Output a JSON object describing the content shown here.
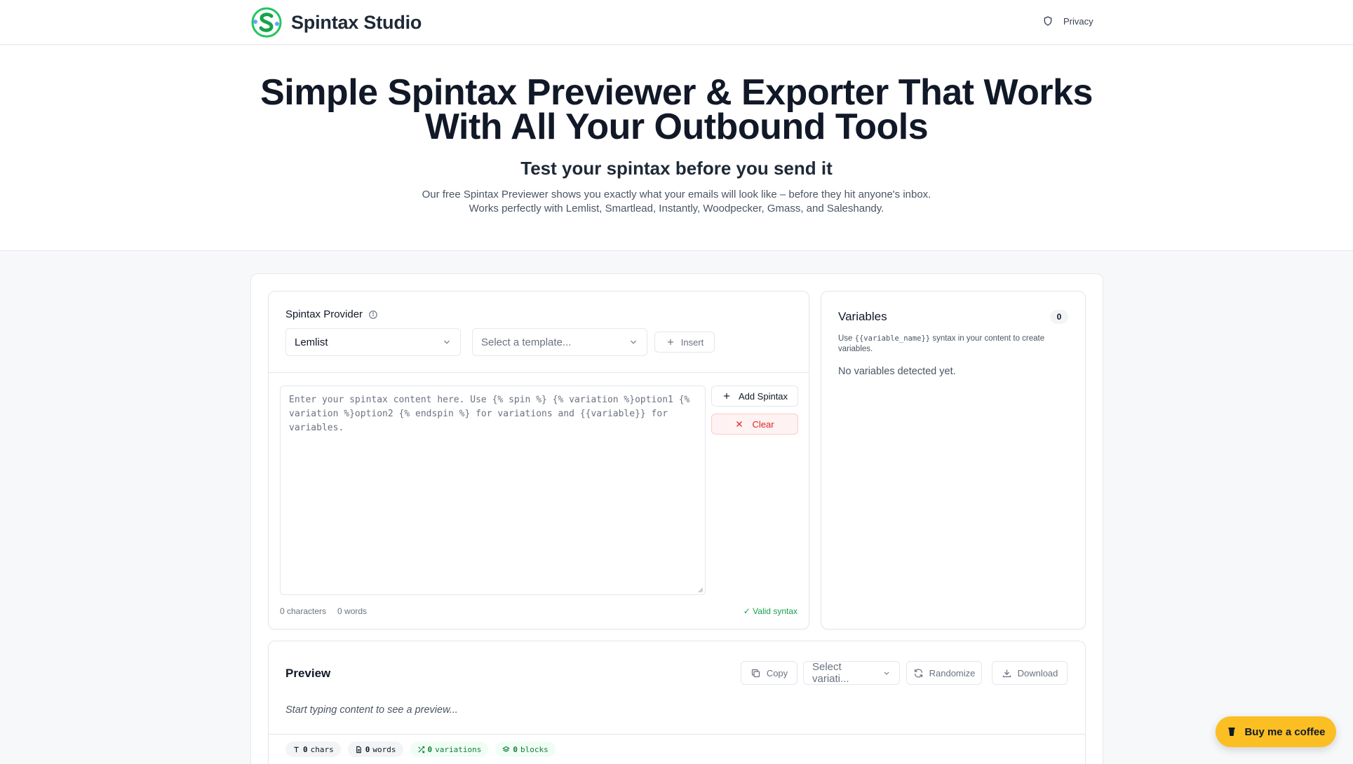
{
  "header": {
    "brand": "Spintax Studio",
    "privacy_label": "Privacy"
  },
  "hero": {
    "title_line1": "Simple Spintax Previewer & Exporter That Works",
    "title_line2": "With All Your Outbound Tools",
    "subtitle": "Test your spintax before you send it",
    "desc_line1": "Our free Spintax Previewer shows you exactly what your emails will look like – before they hit anyone's inbox.",
    "desc_line2": "Works perfectly with Lemlist, Smartlead, Instantly, Woodpecker, Gmass, and Saleshandy."
  },
  "editor": {
    "provider_label": "Spintax Provider",
    "provider_value": "Lemlist",
    "template_placeholder": "Select a template...",
    "insert_label": "Insert",
    "textarea_placeholder": "Enter your spintax content here. Use {% spin %} {% variation %}option1 {% variation %}option2 {% endspin %} for variations and {{variable}} for variables.",
    "add_spintax_label": "Add Spintax",
    "clear_label": "Clear",
    "characters": "0 characters",
    "words": "0 words",
    "valid": "✓ Valid syntax"
  },
  "variables": {
    "title": "Variables",
    "count": "0",
    "help_prefix": "Use ",
    "help_code": "{{variable_name}}",
    "help_suffix": " syntax in your content to create variables.",
    "empty": "No variables detected yet."
  },
  "preview": {
    "title": "Preview",
    "copy_label": "Copy",
    "variation_placeholder": "Select variati...",
    "randomize_label": "Randomize",
    "download_label": "Download",
    "empty": "Start typing content to see a preview...",
    "chips": {
      "chars_num": "0",
      "chars_label": "chars",
      "words_num": "0",
      "words_label": "words",
      "variations_num": "0",
      "variations_label": "variations",
      "blocks_num": "0",
      "blocks_label": "blocks"
    }
  },
  "coffee_label": "Buy me a coffee",
  "colors": {
    "brand_green": "#22c55e",
    "danger": "#dc2626",
    "success": "#16a34a",
    "coffee": "#fbbf24"
  }
}
